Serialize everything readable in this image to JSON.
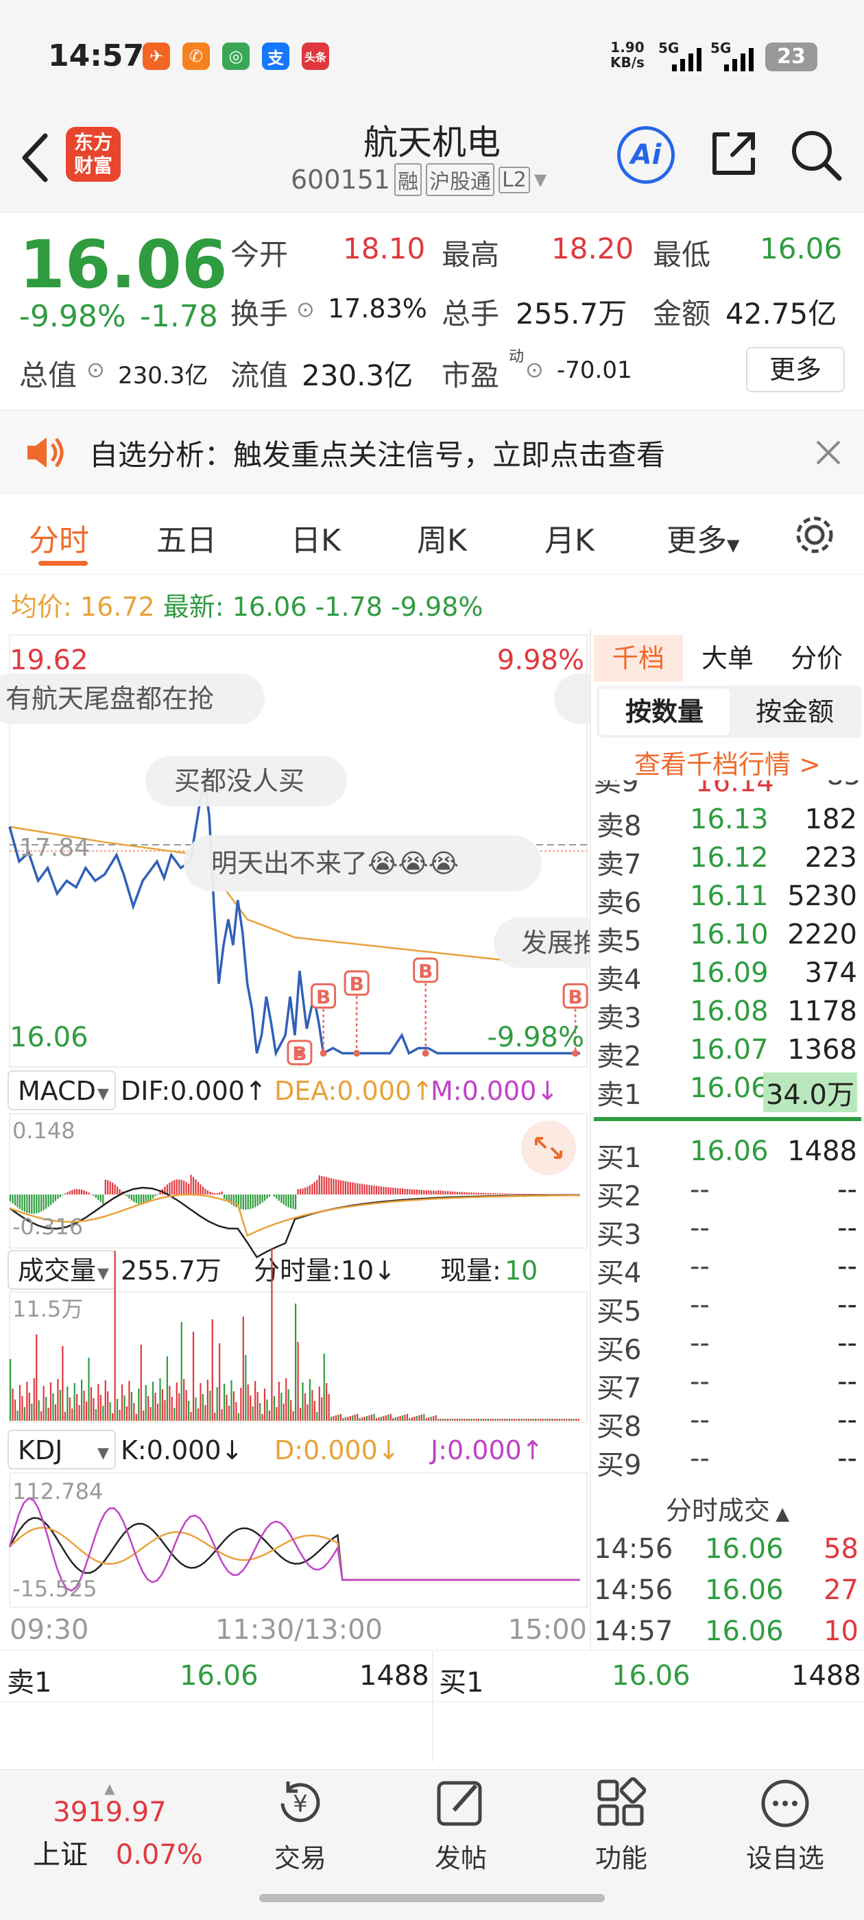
{
  "status_bar": {
    "time": "14:57",
    "net_speed": "1.90",
    "net_unit": "KB/s",
    "sig1": "5G",
    "sig2": "5G",
    "battery": "23",
    "apps": [
      {
        "label": "✈",
        "color": "#f26522"
      },
      {
        "label": "✆",
        "color": "#f58220"
      },
      {
        "label": "◎",
        "color": "#3aa757"
      },
      {
        "label": "支",
        "color": "#1677ff"
      },
      {
        "label": "头条",
        "color": "#e0383e"
      }
    ]
  },
  "header": {
    "logo_line1": "东方",
    "logo_line2": "财富",
    "title": "航天机电",
    "code": "600151",
    "tag1": "融",
    "tag2": "沪股通",
    "tag3": "L2",
    "ai_label": "Ai"
  },
  "quote": {
    "price": "16.06",
    "change_pct": "-9.98%",
    "change_amt": "-1.78",
    "open_label": "今开",
    "open": "18.10",
    "high_label": "最高",
    "high": "18.20",
    "low_label": "最低",
    "low": "16.06",
    "turnover_label": "换手",
    "turnover": "17.83%",
    "volume_label": "总手",
    "volume": "255.7万",
    "amount_label": "金额",
    "amount": "42.75亿",
    "mktcap_label": "总值",
    "mktcap": "230.3亿",
    "float_label": "流值",
    "float_cap": "230.3亿",
    "pe_label": "市盈",
    "pe_sup": "动",
    "pe": "-70.01",
    "more_label": "更多"
  },
  "notice": {
    "text": "自选分析：触发重点关注信号，立即点击查看"
  },
  "tabs": [
    "分时",
    "五日",
    "日K",
    "周K",
    "月K",
    "更多"
  ],
  "summary": {
    "avg_label": "均价:",
    "avg": "16.72",
    "latest_label": "最新:",
    "latest": "16.06",
    "chg": "-1.78",
    "pct": "-9.98%"
  },
  "chart": {
    "y_top": "19.62",
    "pct_top": "9.98%",
    "ref": "17.84",
    "y_bottom": "16.06",
    "pct_bottom": "-9.98%",
    "bullets": [
      "有航天尾盘都在抢",
      "买都没人买",
      "明天出不来了😭😭😭",
      "发展推"
    ],
    "marker": "B",
    "price_line": [
      [
        0,
        17.82
      ],
      [
        4,
        17.55
      ],
      [
        8,
        17.62
      ],
      [
        12,
        17.4
      ],
      [
        16,
        17.5
      ],
      [
        20,
        17.3
      ],
      [
        24,
        17.4
      ],
      [
        28,
        17.35
      ],
      [
        32,
        17.5
      ],
      [
        36,
        17.4
      ],
      [
        40,
        17.45
      ],
      [
        45,
        17.6
      ],
      [
        48,
        17.45
      ],
      [
        52,
        17.2
      ],
      [
        56,
        17.4
      ],
      [
        60,
        17.5
      ],
      [
        62,
        17.55
      ],
      [
        65,
        17.42
      ],
      [
        68,
        17.6
      ],
      [
        72,
        17.5
      ],
      [
        76,
        17.55
      ],
      [
        80,
        18.0
      ],
      [
        82,
        18.18
      ],
      [
        84,
        17.9
      ],
      [
        86,
        17.2
      ],
      [
        88,
        16.6
      ],
      [
        90,
        16.9
      ],
      [
        92,
        17.1
      ],
      [
        94,
        16.9
      ],
      [
        96,
        17.25
      ],
      [
        98,
        17.0
      ],
      [
        100,
        16.6
      ],
      [
        102,
        16.4
      ],
      [
        104,
        16.06
      ],
      [
        106,
        16.2
      ],
      [
        108,
        16.5
      ],
      [
        110,
        16.3
      ],
      [
        112,
        16.06
      ],
      [
        116,
        16.2
      ],
      [
        118,
        16.5
      ],
      [
        120,
        16.2
      ],
      [
        122,
        16.7
      ],
      [
        125,
        16.25
      ],
      [
        128,
        16.5
      ],
      [
        130,
        16.3
      ],
      [
        132,
        16.06
      ],
      [
        136,
        16.1
      ],
      [
        140,
        16.06
      ],
      [
        150,
        16.06
      ],
      [
        160,
        16.06
      ],
      [
        165,
        16.2
      ],
      [
        168,
        16.06
      ],
      [
        172,
        16.1
      ],
      [
        176,
        16.1
      ],
      [
        180,
        16.06
      ],
      [
        185,
        16.06
      ],
      [
        240,
        16.06
      ]
    ],
    "avg_line": [
      [
        0,
        17.82
      ],
      [
        40,
        17.7
      ],
      [
        80,
        17.6
      ],
      [
        86,
        17.45
      ],
      [
        100,
        17.1
      ],
      [
        120,
        16.96
      ],
      [
        140,
        16.92
      ],
      [
        160,
        16.88
      ],
      [
        180,
        16.84
      ],
      [
        200,
        16.8
      ],
      [
        220,
        16.76
      ],
      [
        240,
        16.74
      ]
    ],
    "macd_label": "MACD",
    "dif": "DIF:0.000",
    "dea": "DEA:0.000",
    "m": "M:0.000",
    "macd_hi": "0.148",
    "macd_lo": "-0.316",
    "vol_label": "成交量",
    "vol_total": "255.7万",
    "vol_min": "分时量:10",
    "vol_now_label": "现量:",
    "vol_now": "10",
    "vol_max": "11.5万",
    "kdj_label": "KDJ",
    "k": "K:0.000",
    "d": "D:0.000",
    "j": "J:0.000",
    "kdj_hi": "112.784",
    "kdj_lo": "-15.525",
    "times": [
      "09:30",
      "11:30/13:00",
      "15:00"
    ]
  },
  "orderbook": {
    "tabs": [
      "千档",
      "大单",
      "分价"
    ],
    "sub_tabs": [
      "按数量",
      "按金额"
    ],
    "link": "查看千档行情 >",
    "asks": [
      {
        "label": "卖8",
        "price": "16.13",
        "vol": "182"
      },
      {
        "label": "卖7",
        "price": "16.12",
        "vol": "223"
      },
      {
        "label": "卖6",
        "price": "16.11",
        "vol": "5230"
      },
      {
        "label": "卖5",
        "price": "16.10",
        "vol": "2220"
      },
      {
        "label": "卖4",
        "price": "16.09",
        "vol": "374"
      },
      {
        "label": "卖3",
        "price": "16.08",
        "vol": "1178"
      },
      {
        "label": "卖2",
        "price": "16.07",
        "vol": "1368"
      },
      {
        "label": "卖1",
        "price": "16.06",
        "vol": "34.0万"
      }
    ],
    "bids": [
      {
        "label": "买1",
        "price": "16.06",
        "vol": "1488"
      },
      {
        "label": "买2",
        "price": "--",
        "vol": "--"
      },
      {
        "label": "买3",
        "price": "--",
        "vol": "--"
      },
      {
        "label": "买4",
        "price": "--",
        "vol": "--"
      },
      {
        "label": "买5",
        "price": "--",
        "vol": "--"
      },
      {
        "label": "买6",
        "price": "--",
        "vol": "--"
      },
      {
        "label": "买7",
        "price": "--",
        "vol": "--"
      },
      {
        "label": "买8",
        "price": "--",
        "vol": "--"
      },
      {
        "label": "买9",
        "price": "--",
        "vol": "--"
      }
    ],
    "ticks_title": "分时成交",
    "ticks": [
      {
        "time": "14:56",
        "price": "16.06",
        "vol": "58"
      },
      {
        "time": "14:56",
        "price": "16.06",
        "vol": "27"
      },
      {
        "time": "14:57",
        "price": "16.06",
        "vol": "10"
      }
    ]
  },
  "bottom_quote": {
    "ask_label": "卖1",
    "ask_price": "16.06",
    "ask_vol": "1488",
    "bid_label": "买1",
    "bid_price": "16.06",
    "bid_vol": "1488"
  },
  "index": {
    "value": "3919.97",
    "name": "上证",
    "pct": "0.07%"
  },
  "nav": [
    "交易",
    "发帖",
    "功能",
    "设自选"
  ]
}
